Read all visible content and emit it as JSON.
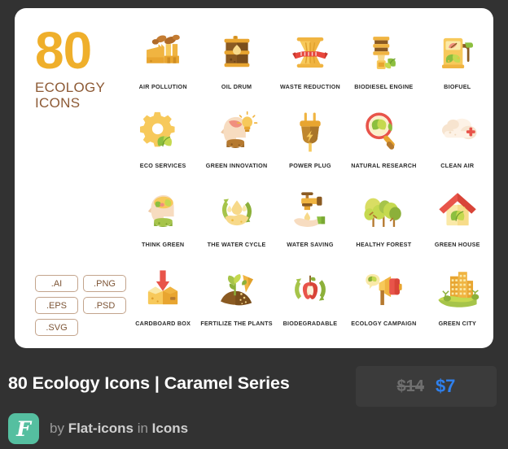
{
  "card": {
    "title": {
      "number": "80",
      "subtitle_line1": "ECOLOGY",
      "subtitle_line2": "ICONS"
    },
    "formats": [
      {
        "label": ".AI"
      },
      {
        "label": ".PNG"
      },
      {
        "label": ".EPS"
      },
      {
        "label": ".PSD"
      },
      {
        "label": ".SVG"
      }
    ],
    "icons": [
      {
        "label": "AIR POLLUTION",
        "icon": "factory-smoke-icon"
      },
      {
        "label": "OIL DRUM",
        "icon": "oil-drum-icon"
      },
      {
        "label": "WASTE  REDUCTION",
        "icon": "waste-basket-ribbon-icon"
      },
      {
        "label": "BIODIESEL ENGINE",
        "icon": "biodiesel-engine-icon"
      },
      {
        "label": "BIOFUEL",
        "icon": "fuel-pump-leaf-icon"
      },
      {
        "label": "ECO SERVICES",
        "icon": "gear-leaf-icon"
      },
      {
        "label": "GREEN INNOVATION",
        "icon": "head-lightbulb-icon"
      },
      {
        "label": "POWER PLUG",
        "icon": "power-plug-icon"
      },
      {
        "label": "NATURAL RESEARCH",
        "icon": "magnifier-leaf-icon"
      },
      {
        "label": "CLEAN AIR",
        "icon": "cloud-plus-icon"
      },
      {
        "label": "THINK GREEN",
        "icon": "head-leaf-brain-icon"
      },
      {
        "label": "THE WATER CYCLE",
        "icon": "water-cycle-icon"
      },
      {
        "label": "WATER SAVING",
        "icon": "tap-hand-drop-icon"
      },
      {
        "label": "HEALTHY FOREST",
        "icon": "forest-trees-icon"
      },
      {
        "label": "GREEN HOUSE",
        "icon": "green-house-icon"
      },
      {
        "label": "CARDBOARD BOX",
        "icon": "cardboard-box-arrow-icon"
      },
      {
        "label": "FERTILIZE THE PLANTS",
        "icon": "fertilize-plant-icon"
      },
      {
        "label": "BIODEGRADABLE",
        "icon": "apple-core-recycle-icon"
      },
      {
        "label": "ECOLOGY CAMPAIGN",
        "icon": "megaphone-leaf-icon"
      },
      {
        "label": "GREEN CITY",
        "icon": "green-city-icon"
      }
    ]
  },
  "footer": {
    "product_title": "80 Ecology Icons | Caramel Series",
    "price_old": "$14",
    "price_new": "$7",
    "avatar_glyph": "F",
    "by_prefix": "by ",
    "author": "Flat-icons",
    "in_word": " in ",
    "category": "Icons"
  },
  "colors": {
    "page_background": "#323232",
    "card_background": "#ffffff",
    "number_accent": "#efaf2b",
    "subtitle_brown": "#8d5a35",
    "badge_border": "#c3a48c",
    "price_pill": "#3b3b3b",
    "price_new": "#2f80ed",
    "price_old": "#6f6f6f",
    "avatar": "#55bfa0"
  }
}
